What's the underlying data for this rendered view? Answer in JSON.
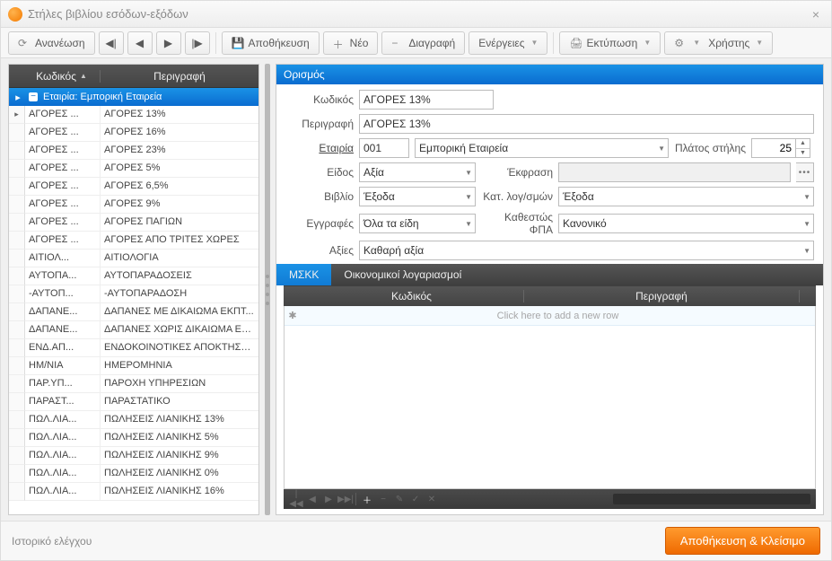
{
  "window": {
    "title": "Στήλες βιβλίου εσόδων-εξόδων"
  },
  "toolbar": {
    "refresh": "Ανανέωση",
    "save": "Αποθήκευση",
    "new": "Νέο",
    "delete": "Διαγραφή",
    "actions": "Ενέργειες",
    "print": "Εκτύπωση",
    "user": "Χρήστης"
  },
  "left": {
    "headers": {
      "code": "Κωδικός",
      "desc": "Περιγραφή"
    },
    "group_label": "Εταιρία: Εμπορική Εταιρεία",
    "rows": [
      {
        "code": "ΑΓΟΡΕΣ ...",
        "desc": "ΑΓΟΡΕΣ 13%"
      },
      {
        "code": "ΑΓΟΡΕΣ ...",
        "desc": "ΑΓΟΡΕΣ 16%"
      },
      {
        "code": "ΑΓΟΡΕΣ ...",
        "desc": "ΑΓΟΡΕΣ  23%"
      },
      {
        "code": "ΑΓΟΡΕΣ ...",
        "desc": "ΑΓΟΡΕΣ 5%"
      },
      {
        "code": "ΑΓΟΡΕΣ ...",
        "desc": "ΑΓΟΡΕΣ 6,5%"
      },
      {
        "code": "ΑΓΟΡΕΣ ...",
        "desc": "ΑΓΟΡΕΣ 9%"
      },
      {
        "code": "ΑΓΟΡΕΣ ...",
        "desc": "ΑΓΟΡΕΣ ΠΑΓΙΩΝ"
      },
      {
        "code": "ΑΓΟΡΕΣ ...",
        "desc": "ΑΓΟΡΕΣ ΑΠΟ ΤΡΙΤΕΣ ΧΩΡΕΣ"
      },
      {
        "code": "ΑΙΤΙΟΛ...",
        "desc": "ΑΙΤΙΟΛΟΓΙΑ"
      },
      {
        "code": "ΑΥΤΟΠΑ...",
        "desc": "ΑΥΤΟΠΑΡΑΔΟΣΕΙΣ"
      },
      {
        "code": "-ΑΥΤΟΠ...",
        "desc": "-ΑΥΤΟΠΑΡΑΔΟΣΗ"
      },
      {
        "code": "ΔΑΠΑΝΕ...",
        "desc": "ΔΑΠΑΝΕΣ ΜΕ ΔΙΚΑΙΩΜΑ ΕΚΠΤ..."
      },
      {
        "code": "ΔΑΠΑΝΕ...",
        "desc": "ΔΑΠΑΝΕΣ ΧΩΡΙΣ ΔΙΚΑΙΩΜΑ ΕΚ..."
      },
      {
        "code": "ΕΝΔ.ΑΠ...",
        "desc": "ΕΝΔΟΚΟΙΝΟΤΙΚΕΣ ΑΠΟΚΤΗΣΕΙΣ"
      },
      {
        "code": "ΗΜ/ΝΙΑ",
        "desc": "ΗΜΕΡΟΜΗΝΙΑ"
      },
      {
        "code": "ΠΑΡ.ΥΠ...",
        "desc": "ΠΑΡΟΧΗ ΥΠΗΡΕΣΙΩΝ"
      },
      {
        "code": "ΠΑΡΑΣΤ...",
        "desc": "ΠΑΡΑΣΤΑΤΙΚΟ"
      },
      {
        "code": "ΠΩΛ.ΛΙΑ...",
        "desc": "ΠΩΛΗΣΕΙΣ ΛΙΑΝΙΚΗΣ 13%"
      },
      {
        "code": "ΠΩΛ.ΛΙΑ...",
        "desc": "ΠΩΛΗΣΕΙΣ ΛΙΑΝΙΚΗΣ 5%"
      },
      {
        "code": "ΠΩΛ.ΛΙΑ...",
        "desc": "ΠΩΛΗΣΕΙΣ ΛΙΑΝΙΚΗΣ 9%"
      },
      {
        "code": "ΠΩΛ.ΛΙΑ...",
        "desc": "ΠΩΛΗΣΕΙΣ ΛΙΑΝΙΚΗΣ 0%"
      },
      {
        "code": "ΠΩΛ.ΛΙΑ...",
        "desc": "ΠΩΛΗΣΕΙΣ ΛΙΑΝΙΚΗΣ 16%"
      }
    ]
  },
  "form": {
    "panel_title": "Ορισμός",
    "labels": {
      "code": "Κωδικός",
      "desc": "Περιγραφή",
      "company": "Εταιρία",
      "colwidth": "Πλάτος στήλης",
      "kind": "Είδος",
      "expr": "Έκφραση",
      "book": "Βιβλίο",
      "acct_cat": "Κατ. λογ/σμών",
      "entries": "Εγγραφές",
      "vat_status": "Καθεστώς ΦΠΑ",
      "values": "Αξίες"
    },
    "values": {
      "code": "ΑΓΟΡΕΣ 13%",
      "desc": "ΑΓΟΡΕΣ 13%",
      "company_code": "001",
      "company_name": "Εμπορική Εταιρεία",
      "colwidth": "25",
      "kind": "Αξία",
      "expr": "",
      "book": "Έξοδα",
      "acct_cat": "Έξοδα",
      "entries": "Όλα τα είδη",
      "vat_status": "Κανονικό",
      "values": "Καθαρή αξία"
    }
  },
  "tabs": {
    "mskk": "ΜΣΚΚ",
    "accounts": "Οικονομικοί λογαριασμοί"
  },
  "subgrid": {
    "headers": {
      "code": "Κωδικός",
      "desc": "Περιγραφή"
    },
    "placeholder": "Click here to add a new row"
  },
  "footer": {
    "history": "Ιστορικό ελέγχου",
    "save_close": "Αποθήκευση & Κλείσιμο"
  }
}
